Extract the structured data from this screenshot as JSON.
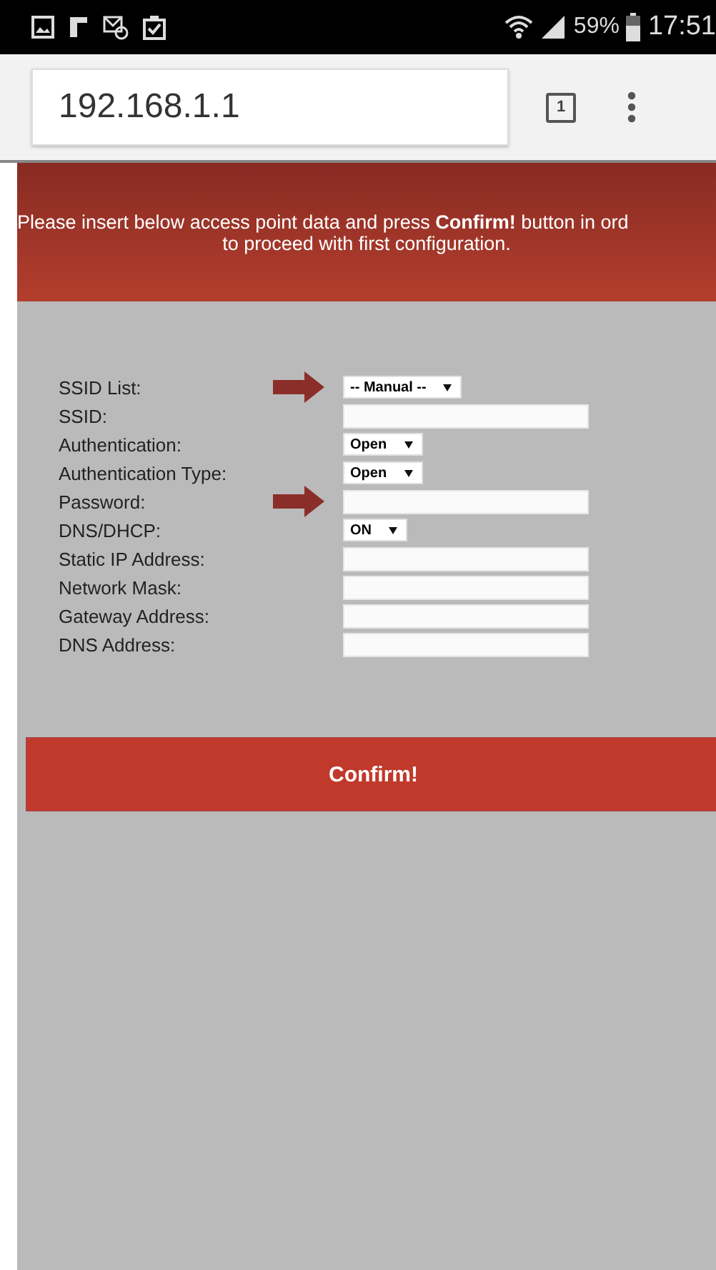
{
  "status_bar": {
    "battery_percent": "59%",
    "time": "17:51"
  },
  "browser": {
    "url": "192.168.1.1",
    "tab_count": "1"
  },
  "banner": {
    "lines": [
      "Please insert below access point data and press **Confirm!** button in ord",
      "to proceed with first configuration."
    ]
  },
  "form": {
    "fields": [
      {
        "label": "SSID List:",
        "kind": "select",
        "value": "-- Manual --",
        "arrow": true
      },
      {
        "label": "SSID:",
        "kind": "text",
        "arrow": false
      },
      {
        "label": "Authentication:",
        "kind": "select",
        "value": "Open",
        "arrow": false
      },
      {
        "label": "Authentication Type:",
        "kind": "select",
        "value": "Open",
        "arrow": false
      },
      {
        "label": "Password:",
        "kind": "text",
        "arrow": true
      },
      {
        "label": "DNS/DHCP:",
        "kind": "select",
        "value": "ON",
        "arrow": false
      },
      {
        "label": "Static IP Address:",
        "kind": "text",
        "arrow": false
      },
      {
        "label": "Network Mask:",
        "kind": "text",
        "arrow": false
      },
      {
        "label": "Gateway Address:",
        "kind": "text",
        "arrow": false
      },
      {
        "label": "DNS Address:",
        "kind": "text",
        "arrow": false
      }
    ]
  },
  "confirm_button": "Confirm!"
}
